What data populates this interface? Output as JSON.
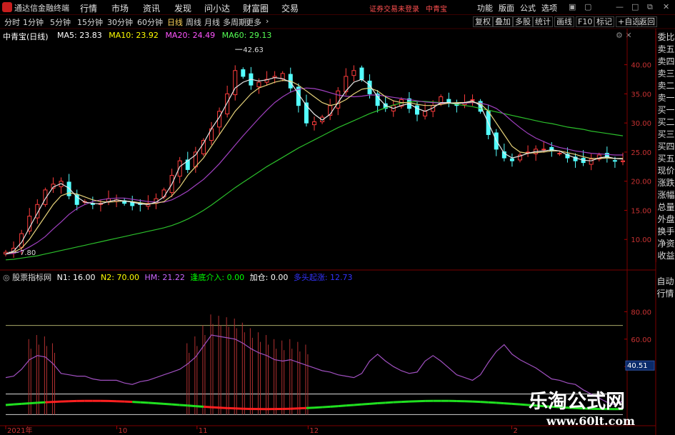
{
  "app_title": "通达信金融终端",
  "menus": [
    "行情",
    "市场",
    "资讯",
    "发现",
    "问小达",
    "财富圈",
    "交易"
  ],
  "notice": "证券交易未登录",
  "notice_name": "中青宝",
  "right_menus": [
    "功能",
    "版面",
    "公式",
    "选项"
  ],
  "periods": [
    "分时",
    "1分钟",
    "5分钟",
    "15分钟",
    "30分钟",
    "60分钟",
    "日线",
    "周线",
    "月线",
    "多周期",
    "更多"
  ],
  "active_period": "日线",
  "tool_buttons": [
    "复权",
    "叠加",
    "多股",
    "统计",
    "画线",
    "F10",
    "标记",
    "+自选",
    "返回"
  ],
  "stock_name": "中青宝(日线)",
  "ma": [
    {
      "label": "MA5: 23.83",
      "color": "#ffffff"
    },
    {
      "label": "MA10: 23.92",
      "color": "#ffff00"
    },
    {
      "label": "MA20: 24.49",
      "color": "#ff55ff"
    },
    {
      "label": "MA60: 29.13",
      "color": "#55ff55"
    }
  ],
  "indicator": {
    "name": "股票指标网",
    "items": [
      {
        "label": "N1: 16.00",
        "color": "#ffffff"
      },
      {
        "label": "N2: 70.00",
        "color": "#ffff00"
      },
      {
        "label": "HM: 21.22",
        "color": "#cc66ff"
      },
      {
        "label": "逢底介入: 0.00",
        "color": "#00ff00"
      },
      {
        "label": "加仓: 0.00",
        "color": "#ffffff"
      },
      {
        "label": "多头起涨: 12.73",
        "color": "#3333ff"
      }
    ]
  },
  "side_panel": [
    "委比",
    "卖五",
    "卖四",
    "卖三",
    "卖二",
    "卖一",
    "买一",
    "买二",
    "买三",
    "买四",
    "买五",
    "现价",
    "涨跌",
    "涨幅",
    "总量",
    "外盘",
    "换手",
    "净资",
    "收益"
  ],
  "side_panel2": [
    "自动",
    "行情"
  ],
  "chart_data": {
    "type": "candlestick",
    "price_axis": [
      "40.00",
      "35.00",
      "30.00",
      "25.00",
      "20.00",
      "15.00",
      "10.00"
    ],
    "indicator_axis": [
      "80.00",
      "60.00",
      "40.00"
    ],
    "indicator_current": "40.51",
    "dates": [
      "2021年",
      "10",
      "11",
      "12",
      "2"
    ],
    "high_label": "42.63",
    "low_label": "7.80",
    "ylim": [
      5,
      44
    ],
    "ylim_indicator": [
      0,
      100
    ],
    "ref_lines": [
      70,
      5
    ],
    "ma5": [
      7.5,
      8,
      9.5,
      12,
      14.5,
      17,
      19,
      19.6,
      18.8,
      17.3,
      16.4,
      16.2,
      16.1,
      16.5,
      16.8,
      16.6,
      16.4,
      16.1,
      16,
      16.4,
      17.3,
      19.5,
      22.5,
      23.5,
      24.5,
      26.5,
      29,
      31,
      33.5,
      36,
      37,
      37.5,
      37.2,
      37.4,
      37.8,
      37.6,
      37,
      35,
      33,
      31.5,
      30.5,
      31.5,
      33.5,
      35.5,
      37,
      37.5,
      36.5,
      34.5,
      33,
      32.5,
      33,
      33.3,
      32.5,
      32,
      32.6,
      33.5,
      33.5,
      33.3,
      33.5,
      33.8,
      33,
      30,
      27,
      24.8,
      24,
      24.3,
      24.8,
      25.1,
      25.2,
      25.4,
      25.2,
      24.5,
      24,
      23.6,
      23.5,
      24,
      24.2,
      23.9,
      23.8
    ],
    "ma10": [
      7.5,
      7.8,
      8.5,
      10,
      12,
      14,
      16,
      17.5,
      18,
      17.8,
      17.3,
      16.8,
      16.5,
      16.4,
      16.5,
      16.6,
      16.5,
      16.3,
      16.1,
      16.2,
      16.5,
      17.5,
      19,
      21,
      22.5,
      24,
      26,
      28,
      30,
      32,
      33.5,
      35,
      36,
      36.5,
      37,
      37.3,
      37.2,
      36.5,
      35.5,
      34.5,
      33.5,
      33,
      33.3,
      34,
      35,
      35.8,
      36,
      35.5,
      34.5,
      33.8,
      33.5,
      33.5,
      33.2,
      33,
      33,
      33.2,
      33.4,
      33.5,
      33.5,
      33.6,
      33.3,
      32,
      30,
      28,
      26,
      25,
      24.8,
      24.9,
      25,
      25.2,
      25.2,
      24.9,
      24.6,
      24.2,
      23.9,
      23.9,
      24,
      23.9,
      23.9
    ],
    "ma20": [
      7.5,
      7.6,
      8,
      8.7,
      9.5,
      10.5,
      11.8,
      13,
      14.3,
      15.3,
      16,
      16.5,
      16.8,
      17,
      17.1,
      17.1,
      16.9,
      16.7,
      16.5,
      16.4,
      16.4,
      16.8,
      17.5,
      18.3,
      19.3,
      20.3,
      21.6,
      23,
      24.6,
      26.2,
      27.8,
      29.3,
      30.8,
      32.2,
      33.5,
      34.5,
      35.3,
      35.8,
      36,
      35.9,
      35.6,
      35.2,
      34.8,
      34.6,
      34.5,
      34.6,
      34.8,
      34.8,
      34.6,
      34.4,
      34.2,
      34,
      33.8,
      33.6,
      33.5,
      33.4,
      33.4,
      33.4,
      33.4,
      33.5,
      33.4,
      33.1,
      32.5,
      31.5,
      30.3,
      29.2,
      28.2,
      27.4,
      26.8,
      26.2,
      25.8,
      25.5,
      25.2,
      25,
      24.8,
      24.7,
      24.6,
      24.5,
      24.5
    ],
    "ma60": [
      6.5,
      6.6,
      6.8,
      7,
      7.2,
      7.5,
      7.8,
      8.1,
      8.4,
      8.7,
      9,
      9.3,
      9.6,
      9.9,
      10.2,
      10.5,
      10.8,
      11.1,
      11.4,
      11.7,
      12,
      12.4,
      12.9,
      13.5,
      14.2,
      15,
      15.9,
      16.9,
      17.9,
      18.9,
      19.8,
      20.7,
      21.6,
      22.5,
      23.3,
      24.1,
      24.9,
      25.7,
      26.4,
      27.1,
      27.8,
      28.5,
      29.2,
      29.8,
      30.4,
      31,
      31.6,
      32.1,
      32.6,
      33.1,
      33.4,
      33.6,
      33.7,
      33.7,
      33.6,
      33.5,
      33.4,
      33.2,
      33,
      32.8,
      32.5,
      32.2,
      31.9,
      31.6,
      31.3,
      31,
      30.7,
      30.4,
      30.1,
      29.9,
      29.6,
      29.3,
      29.1,
      28.9,
      28.6,
      28.4,
      28.2,
      28,
      27.8
    ],
    "closes": [
      7.8,
      8.5,
      11,
      14,
      16,
      18.5,
      19.5,
      20,
      17.5,
      16,
      16.5,
      16,
      16.2,
      17,
      16.8,
      16.2,
      15.8,
      16,
      16.2,
      17,
      18.5,
      21,
      23.5,
      22,
      25,
      27,
      29,
      32,
      35,
      39,
      38,
      36.5,
      37,
      37.5,
      38,
      38.5,
      36,
      33,
      30,
      30.2,
      31,
      33,
      35.5,
      38,
      39,
      37.5,
      35,
      33,
      32.5,
      33,
      34,
      32.5,
      31.5,
      32,
      33,
      34.5,
      33.5,
      33,
      33.5,
      34,
      32,
      28,
      25.5,
      24,
      23.5,
      24.5,
      25,
      25.5,
      25.5,
      25.2,
      24.8,
      24,
      23.5,
      23.2,
      23.8,
      24.5,
      24,
      23.5,
      23.5
    ],
    "hm": [
      32,
      33,
      38,
      45,
      48,
      47,
      42,
      35,
      34,
      33,
      33,
      31,
      30,
      30,
      30,
      28,
      27,
      29,
      30,
      32,
      34,
      36,
      38,
      42,
      47,
      55,
      63,
      62,
      61,
      60,
      57,
      53,
      50,
      48,
      45,
      44,
      45,
      43,
      41,
      39,
      37,
      36,
      34,
      33,
      32,
      35,
      44,
      49,
      44,
      40,
      37,
      35,
      36,
      44,
      48,
      44,
      39,
      34,
      32,
      30,
      34,
      43,
      51,
      56,
      49,
      45,
      42,
      39,
      35,
      31,
      30,
      28,
      27,
      23,
      20,
      17,
      14,
      12,
      15
    ]
  }
}
